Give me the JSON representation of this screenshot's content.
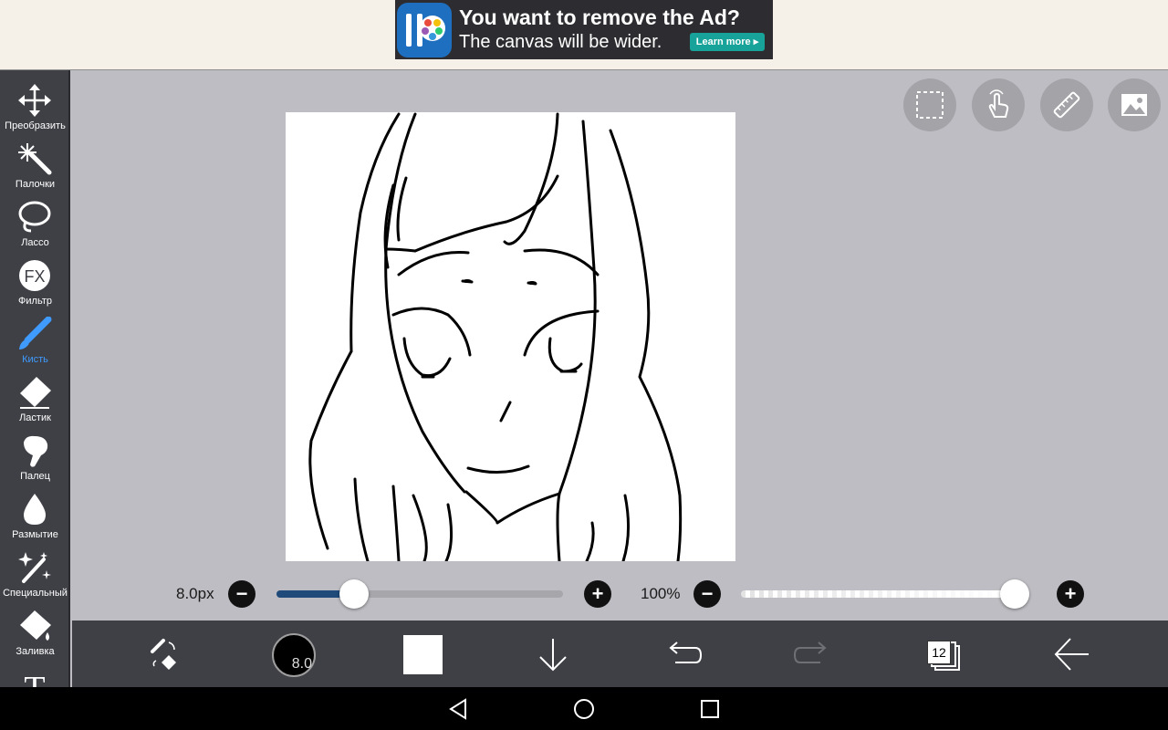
{
  "ad": {
    "title": "You want to remove the Ad?",
    "subtitle": "The canvas will be wider.",
    "cta": "Learn more ▸"
  },
  "tools": [
    {
      "id": "transform",
      "label": "Преобразить",
      "icon": "move-arrows-icon"
    },
    {
      "id": "magic-wand",
      "label": "Палочки",
      "icon": "magic-wand-icon"
    },
    {
      "id": "lasso",
      "label": "Лассо",
      "icon": "lasso-icon"
    },
    {
      "id": "filter",
      "label": "Фильтр",
      "icon": "fx-icon",
      "icon_text": "FX"
    },
    {
      "id": "brush",
      "label": "Кисть",
      "icon": "brush-icon",
      "active": true
    },
    {
      "id": "eraser",
      "label": "Ластик",
      "icon": "eraser-icon"
    },
    {
      "id": "smudge",
      "label": "Палец",
      "icon": "smudge-finger-icon"
    },
    {
      "id": "blur",
      "label": "Размытие",
      "icon": "blur-drop-icon"
    },
    {
      "id": "special",
      "label": "Специальный",
      "icon": "special-sparkle-icon"
    },
    {
      "id": "fill",
      "label": "Заливка",
      "icon": "fill-bucket-icon"
    },
    {
      "id": "text",
      "label": "",
      "icon": "text-tool-icon",
      "icon_text": "T"
    }
  ],
  "canvas_buttons": [
    {
      "id": "selection",
      "icon": "selection-dashed-icon"
    },
    {
      "id": "hand",
      "icon": "hand-touch-icon"
    },
    {
      "id": "ruler",
      "icon": "ruler-icon"
    },
    {
      "id": "gallery",
      "icon": "image-icon"
    }
  ],
  "brush_size": {
    "label": "8.0px",
    "value": 8.0,
    "fraction": 0.27
  },
  "opacity": {
    "label": "100%",
    "value": 100,
    "fraction": 1.0
  },
  "bottom_bar": {
    "brush_indicator": "8.0",
    "current_color": "#ffffff",
    "layer_count": "12"
  },
  "colors": {
    "toolbar_bg": "#3f4046",
    "canvas_bg": "#bdbdc3",
    "accent": "#3f9bff",
    "slider_fill": "#1f4a7a"
  }
}
